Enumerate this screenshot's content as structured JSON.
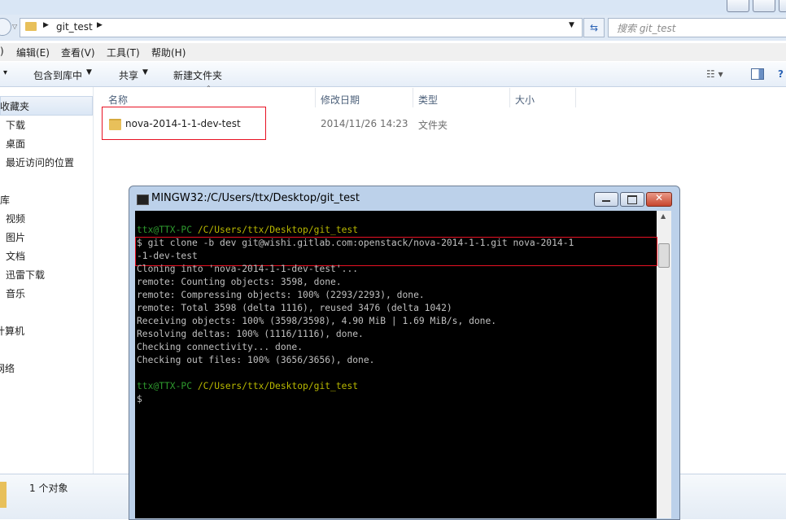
{
  "explorer": {
    "address": {
      "crumb": "git_test"
    },
    "search": {
      "placeholder": "搜索 git_test"
    },
    "menu": [
      "编辑(E)",
      "查看(V)",
      "工具(T)",
      "帮助(H)"
    ],
    "menu_partial": ")",
    "toolbar": {
      "organize_fragment": "▾",
      "include_library": "包含到库中",
      "share": "共享",
      "new_folder": "新建文件夹"
    },
    "nav": {
      "favorites": "收藏夹",
      "fav_items": [
        "下载",
        "桌面",
        "最近访问的位置"
      ],
      "libraries": "库",
      "lib_items": [
        "视频",
        "图片",
        "文档",
        "迅雷下载",
        "音乐"
      ],
      "computer": "计算机",
      "network": "网络"
    },
    "columns": [
      "名称",
      "修改日期",
      "类型",
      "大小"
    ],
    "files": [
      {
        "name": "nova-2014-1-1-dev-test",
        "modified": "2014/11/26 14:23",
        "type": "文件夹",
        "size": ""
      }
    ],
    "status": "1 个对象"
  },
  "terminal": {
    "title": "MINGW32:/C/Users/ttx/Desktop/git_test",
    "prompt_user": "ttx@TTX-PC",
    "prompt_path": "/C/Users/ttx/Desktop/git_test",
    "command_line1": "$ git clone -b dev git@wishi.gitlab.com:openstack/nova-2014-1-1.git nova-2014-1",
    "command_line2": "-1-dev-test",
    "output": [
      "Cloning into 'nova-2014-1-1-dev-test'...",
      "remote: Counting objects: 3598, done.",
      "remote: Compressing objects: 100% (2293/2293), done.",
      "remote: Total 3598 (delta 1116), reused 3476 (delta 1042)",
      "Receiving objects: 100% (3598/3598), 4.90 MiB | 1.69 MiB/s, done.",
      "Resolving deltas: 100% (1116/1116), done.",
      "Checking connectivity... done.",
      "Checking out files: 100% (3656/3656), done."
    ],
    "prompt_symbol": "$"
  },
  "colors": {
    "terminal_bg": "#000000",
    "prompt_green": "#2e9a2e",
    "path_yellow": "#b8b800",
    "highlight_red": "#e81123"
  }
}
